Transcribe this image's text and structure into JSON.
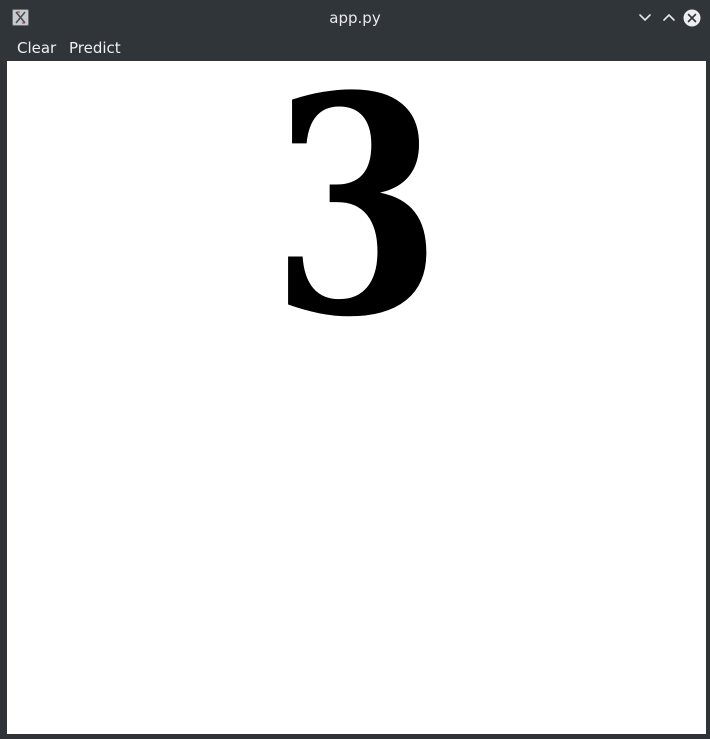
{
  "window": {
    "title": "app.py",
    "icons": {
      "app": "x-app-icon",
      "minimize": "chevron-down-icon",
      "maximize": "chevron-up-icon",
      "close": "close-circle-icon"
    }
  },
  "menubar": {
    "items": [
      {
        "label": "Clear"
      },
      {
        "label": "Predict"
      }
    ]
  },
  "canvas": {
    "drawn_digit": "3"
  },
  "colors": {
    "titlebar_bg": "#30353a",
    "titlebar_text": "#e8eaec",
    "canvas_bg": "#ffffff",
    "ink": "#000000"
  }
}
